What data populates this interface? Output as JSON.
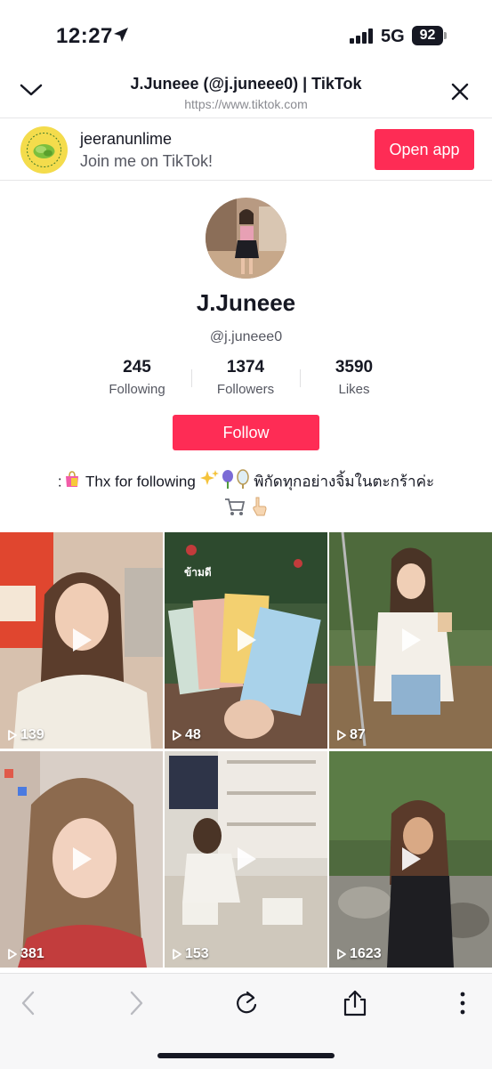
{
  "status": {
    "time": "12:27",
    "network": "5G",
    "battery": "92"
  },
  "browser": {
    "title": "J.Juneee (@j.juneee0) | TikTok",
    "url": "https://www.tiktok.com"
  },
  "banner": {
    "account": "jeeranunlime",
    "subtitle": "Join me on TikTok!",
    "open_label": "Open app"
  },
  "profile": {
    "name": "J.Juneee",
    "handle": "@j.juneee0",
    "stats": [
      {
        "value": "245",
        "label": "Following"
      },
      {
        "value": "1374",
        "label": "Followers"
      },
      {
        "value": "3590",
        "label": "Likes"
      }
    ],
    "follow_label": "Follow",
    "bio_prefix": ":",
    "bio_text": "Thx for following",
    "bio_thai": "พิกัดทุกอย่างจิ้มในตะกร้าค่ะ"
  },
  "videos": [
    {
      "views": "139"
    },
    {
      "views": "48",
      "caption": "ข้ามดี"
    },
    {
      "views": "87"
    },
    {
      "views": "381"
    },
    {
      "views": "153"
    },
    {
      "views": "1623"
    }
  ],
  "colors": {
    "accent": "#fe2c55",
    "text": "#161823",
    "muted": "#555761"
  },
  "icons": [
    "location-arrow-icon",
    "signal-icon",
    "chevron-down-icon",
    "close-icon",
    "play-icon",
    "back-icon",
    "forward-icon",
    "reload-icon",
    "share-icon",
    "more-icon"
  ]
}
